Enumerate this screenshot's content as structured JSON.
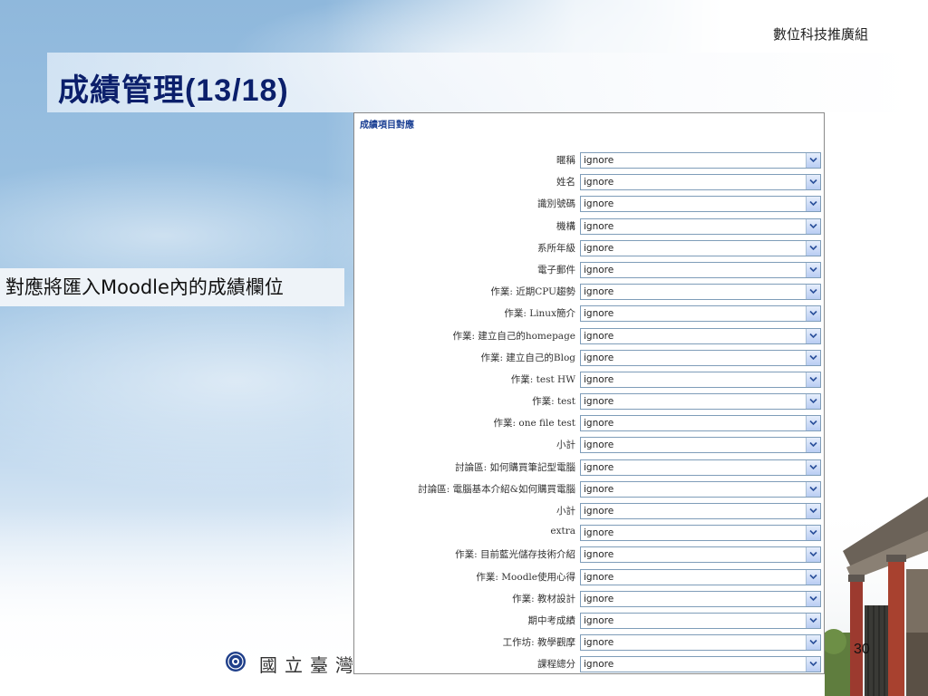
{
  "header": {
    "org": "數位科技推廣組",
    "title": "成績管理(13/18)"
  },
  "note": "對應將匯入Moodle內的成績欄位",
  "panel": {
    "title": "成績項目對應",
    "rows": [
      {
        "label": "暱稱",
        "value": "ignore"
      },
      {
        "label": "姓名",
        "value": "ignore"
      },
      {
        "label": "識別號碼",
        "value": "ignore"
      },
      {
        "label": "機構",
        "value": "ignore"
      },
      {
        "label": "系所年級",
        "value": "ignore"
      },
      {
        "label": "電子郵件",
        "value": "ignore"
      },
      {
        "label": "作業: 近期CPU趨勢",
        "value": "ignore"
      },
      {
        "label": "作業: Linux簡介",
        "value": "ignore"
      },
      {
        "label": "作業: 建立自己的homepage",
        "value": "ignore"
      },
      {
        "label": "作業: 建立自己的Blog",
        "value": "ignore"
      },
      {
        "label": "作業: test HW",
        "value": "ignore"
      },
      {
        "label": "作業: test",
        "value": "ignore"
      },
      {
        "label": "作業: one file test",
        "value": "ignore"
      },
      {
        "label": "小計",
        "value": "ignore"
      },
      {
        "label": "討論區: 如何購買筆記型電腦",
        "value": "ignore"
      },
      {
        "label": "討論區: 電腦基本介紹&如何購買電腦",
        "value": "ignore"
      },
      {
        "label": "小計",
        "value": "ignore"
      },
      {
        "label": "extra",
        "value": "ignore"
      },
      {
        "label": "作業: 目前藍光儲存技術介紹",
        "value": "ignore"
      },
      {
        "label": "作業: Moodle使用心得",
        "value": "ignore"
      },
      {
        "label": "作業: 教材設計",
        "value": "ignore"
      },
      {
        "label": "期中考成績",
        "value": "ignore"
      },
      {
        "label": "工作坊: 教學觀摩",
        "value": "ignore"
      },
      {
        "label": "課程總分",
        "value": "ignore"
      }
    ]
  },
  "footer": {
    "logo_text": "國立臺灣",
    "page_number": "30",
    "logo_icon": "university-seal-icon"
  },
  "colors": {
    "title": "#0b1f6b",
    "panel_title": "#1a3f93",
    "select_border": "#7f9db9"
  }
}
